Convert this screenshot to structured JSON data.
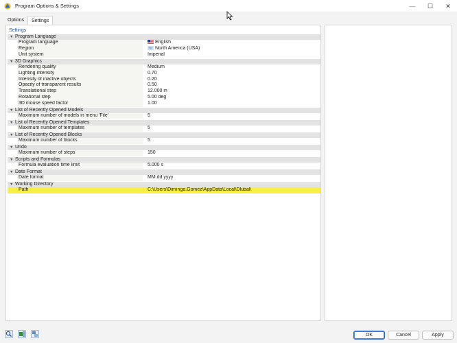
{
  "window": {
    "title": "Program Options & Settings"
  },
  "controls": {
    "minimize": "—",
    "maximize": "☐",
    "close": "✕"
  },
  "tabs": [
    {
      "label": "Options",
      "active": false
    },
    {
      "label": "Settings",
      "active": true
    }
  ],
  "breadcrumb": "Settings",
  "sections": [
    {
      "title": "Program Language",
      "rows": [
        {
          "label": "Program language",
          "value": "English",
          "icon": "us-flag-icon"
        },
        {
          "label": "Region",
          "value": "North America (USA)",
          "icon": "region-map-icon"
        },
        {
          "label": "Unit system",
          "value": "Imperial"
        }
      ]
    },
    {
      "title": "3D Graphics",
      "rows": [
        {
          "label": "Rendering quality",
          "value": "Medium"
        },
        {
          "label": "Lighting intensity",
          "value": "0.70"
        },
        {
          "label": "Intensity of inactive objects",
          "value": "0.20"
        },
        {
          "label": "Opacity of transparent results",
          "value": "0.50"
        },
        {
          "label": "Translational step",
          "value": "12.000 in"
        },
        {
          "label": "Rotational step",
          "value": "5.00 deg"
        },
        {
          "label": "3D mouse speed factor",
          "value": "1.00"
        }
      ]
    },
    {
      "title": "List of Recently Opened Models",
      "rows": [
        {
          "label": "Maximum number of models in menu 'File'",
          "value": "5"
        }
      ]
    },
    {
      "title": "List of Recently Opened Templates",
      "rows": [
        {
          "label": "Maximum number of templates",
          "value": "5"
        }
      ]
    },
    {
      "title": "List of Recently Opened Blocks",
      "rows": [
        {
          "label": "Maximum number of blocks",
          "value": "5"
        }
      ]
    },
    {
      "title": "Undo",
      "rows": [
        {
          "label": "Maximum number of steps",
          "value": "150"
        }
      ]
    },
    {
      "title": "Scripts and Formulas",
      "rows": [
        {
          "label": "Formula evaluation time limit",
          "value": "5.000 s"
        }
      ]
    },
    {
      "title": "Date Format",
      "rows": [
        {
          "label": "Date format",
          "value": "MM.dd.yyyy"
        }
      ]
    },
    {
      "title": "Working Directory",
      "rows": [
        {
          "label": "Path",
          "value": "C:\\Users\\Dimınga.Gomez\\AppData\\Local\\Dlubal\\",
          "highlighted": true
        }
      ]
    }
  ],
  "buttons": {
    "ok": "OK",
    "cancel": "Cancel",
    "apply": "Apply"
  },
  "bottom_icons": [
    "search-icon",
    "table-export-icon",
    "settings-transfer-icon"
  ],
  "colors": {
    "highlight": "#f7ef44",
    "section_header": "#e3e3e3",
    "link": "#2a5fa8"
  }
}
